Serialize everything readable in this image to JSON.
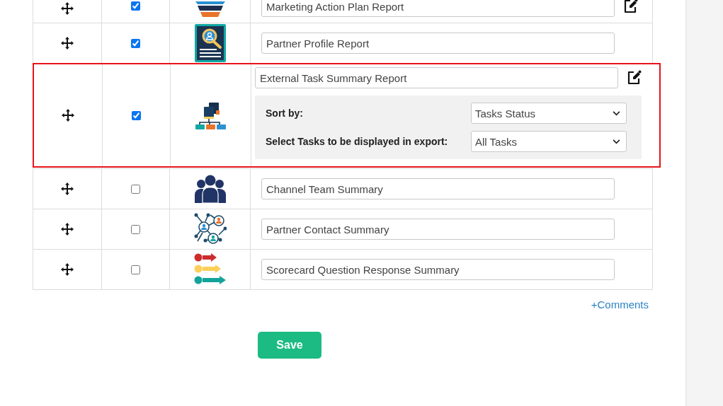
{
  "rows": [
    {
      "title": "Marketing Action Plan Report",
      "checked": true,
      "editable": true,
      "highlighted": false
    },
    {
      "title": "Partner Profile Report",
      "checked": true,
      "editable": false,
      "highlighted": false
    },
    {
      "title": "External Task Summary Report",
      "checked": true,
      "editable": true,
      "highlighted": true,
      "options": [
        {
          "label": "Sort by:",
          "value": "Tasks Status"
        },
        {
          "label": "Select Tasks to be displayed in export:",
          "value": "All Tasks"
        }
      ]
    },
    {
      "title": "Channel Team Summary",
      "checked": false,
      "editable": false,
      "highlighted": false
    },
    {
      "title": "Partner Contact Summary",
      "checked": false,
      "editable": false,
      "highlighted": false
    },
    {
      "title": "Scorecard Question Response Summary",
      "checked": false,
      "editable": false,
      "highlighted": false
    }
  ],
  "comments_link": "+Comments",
  "save_button": "Save"
}
